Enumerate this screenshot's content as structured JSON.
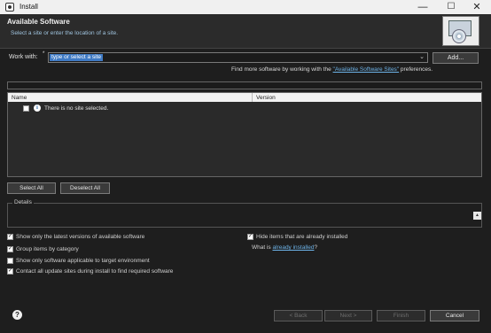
{
  "window": {
    "title": "Install",
    "min_glyph": "—",
    "max_glyph": "☐",
    "close_glyph": "✕"
  },
  "header": {
    "title": "Available Software",
    "subtitle": "Select a site or enter the location of a site."
  },
  "work_with": {
    "label": "Work with:",
    "required_mark": "*",
    "value": "type or select a site",
    "dropdown_glyph": "⌄",
    "add_label": "Add..."
  },
  "more_software": {
    "prefix": "Find more software by working with the ",
    "link": "\"Available Software Sites\"",
    "suffix": " preferences."
  },
  "tree": {
    "columns": [
      "Name",
      "Version"
    ],
    "message": "There is no site selected.",
    "info_glyph": "i"
  },
  "buttons": {
    "select_all": "Select All",
    "deselect_all": "Deselect All"
  },
  "details": {
    "label": "Details",
    "scroll_glyph": "▲"
  },
  "options": [
    {
      "label": "Show only the latest versions of available software",
      "checked": true
    },
    {
      "label": "Group items by category",
      "checked": true
    },
    {
      "label": "Show only software applicable to target environment",
      "checked": false
    },
    {
      "label": "Contact all update sites during install to find required software",
      "checked": true
    },
    {
      "label": "Hide items that are already installed",
      "checked": true
    }
  ],
  "what_is": {
    "prefix": "What is ",
    "link": "already installed",
    "suffix": "?"
  },
  "footer": {
    "help_glyph": "?",
    "back": "< Back",
    "next": "Next >",
    "finish": "Finish",
    "cancel": "Cancel"
  },
  "colors": {
    "accent": "#3f7ac4",
    "link": "#6db3e8",
    "background": "#1e1e1e"
  }
}
